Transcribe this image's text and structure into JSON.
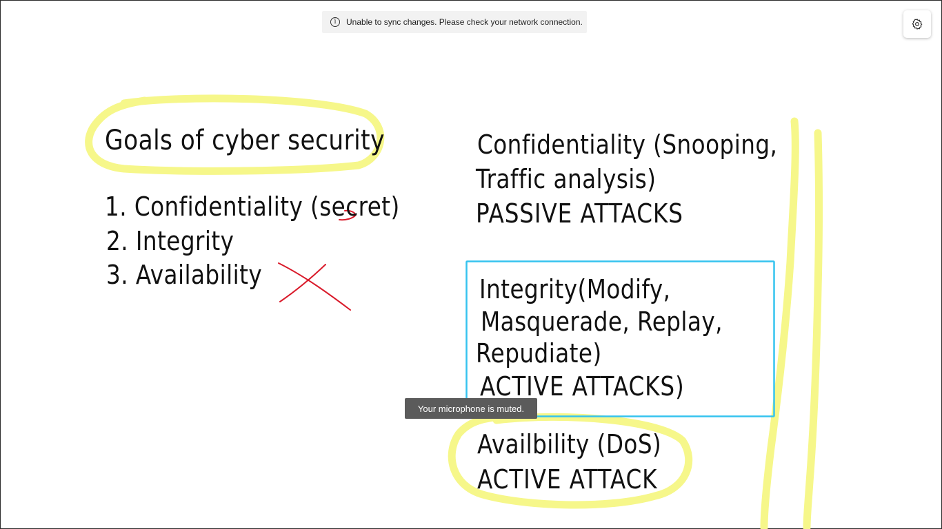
{
  "banner": {
    "icon": "info-icon",
    "text": "Unable to sync changes. Please check your network connection."
  },
  "settings": {
    "icon": "gear-icon"
  },
  "toast": {
    "text": "Your microphone is muted."
  },
  "colors": {
    "ink": "#111111",
    "highlighter": "#f6f78a",
    "red_ink": "#d91a2a",
    "selection_box": "#35c3ef"
  },
  "board": {
    "left": {
      "title": "Goals of cyber security",
      "items": [
        "1. Confidentiality (secret)",
        "2. Integrity",
        "3. Availability"
      ]
    },
    "right": {
      "confidentiality": {
        "line1": "Confidentiality (Snooping,",
        "line2": "Traffic analysis)",
        "line3": "PASSIVE ATTACKS"
      },
      "integrity": {
        "line1": "Integrity(Modify,",
        "line2": "Masquerade, Replay,",
        "line3": "Repudiate)",
        "line4": "ACTIVE ATTACKS)"
      },
      "availability": {
        "line1": "Availbility (DoS)",
        "line2": "ACTIVE ATTACK"
      }
    }
  }
}
